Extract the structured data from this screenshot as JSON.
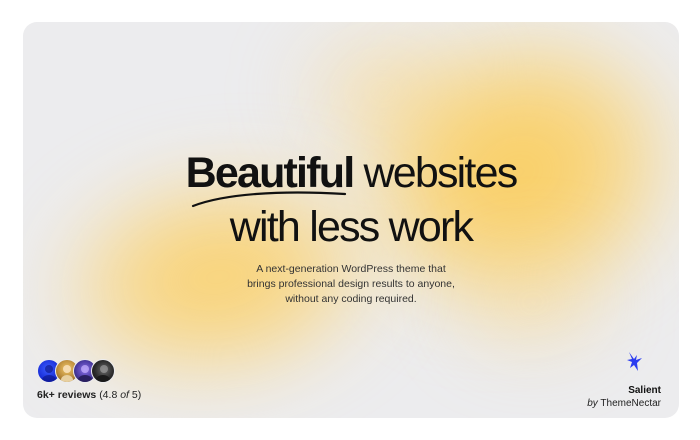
{
  "hero": {
    "headline_bold": "Beautiful",
    "headline_rest_line1": "websites",
    "headline_line2": "with less work",
    "subtext_lines": [
      "A next-generation WordPress theme that",
      "brings professional design results to anyone,",
      "without any coding required."
    ]
  },
  "social_proof": {
    "avatars": [
      "avatar-1",
      "avatar-2",
      "avatar-3",
      "avatar-4"
    ],
    "reviews_count": "6k+ reviews",
    "rating_open": "(4.8",
    "rating_of": "of",
    "rating_close": "5)"
  },
  "brand": {
    "name": "Salient",
    "by": "by",
    "company": "ThemeNectar",
    "icon": "hummingbird-icon"
  },
  "colors": {
    "background": "#ececee",
    "accent_glow": "#fbca50",
    "brand_blue": "#2b3cf0",
    "text": "#111111"
  }
}
